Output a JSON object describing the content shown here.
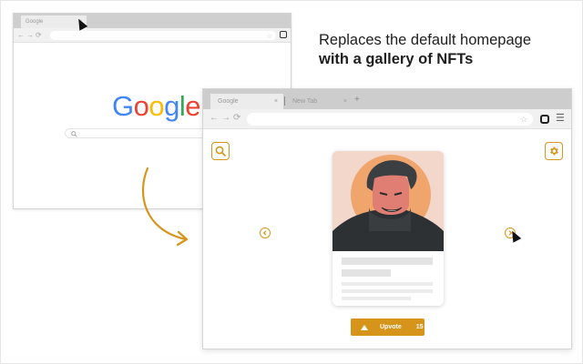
{
  "headline": {
    "line1": "Replaces the default homepage",
    "line2": "with a gallery of NFTs"
  },
  "browser1": {
    "tab_title": "Google",
    "tab_close": "×",
    "nav_icons": "←→⟳",
    "logo_letters": [
      {
        "char": "G",
        "color": "#4285F4"
      },
      {
        "char": "o",
        "color": "#EA4335"
      },
      {
        "char": "o",
        "color": "#FBBC05"
      },
      {
        "char": "g",
        "color": "#4285F4"
      },
      {
        "char": "l",
        "color": "#34A853"
      },
      {
        "char": "e",
        "color": "#EA4335"
      }
    ]
  },
  "browser2": {
    "tabs": [
      {
        "label": "Google",
        "close": "×"
      },
      {
        "label": "New Tab",
        "close": "×"
      }
    ],
    "new_tab_icon": "+",
    "nav_icons": "←→⟳",
    "upvote": {
      "label": "Upvote",
      "count": "15"
    }
  },
  "icons": {
    "star": "☆",
    "menu": "☰",
    "search_icon": "search-icon",
    "settings_icon": "gear-icon",
    "prev_icon": "chevron-left-icon",
    "next_icon": "chevron-right-icon",
    "upvote_icon": "triangle-up-icon",
    "arrow_icon": "curved-arrow-icon"
  },
  "colors": {
    "accent": "#d6941a",
    "arrow": "#d6941a"
  }
}
